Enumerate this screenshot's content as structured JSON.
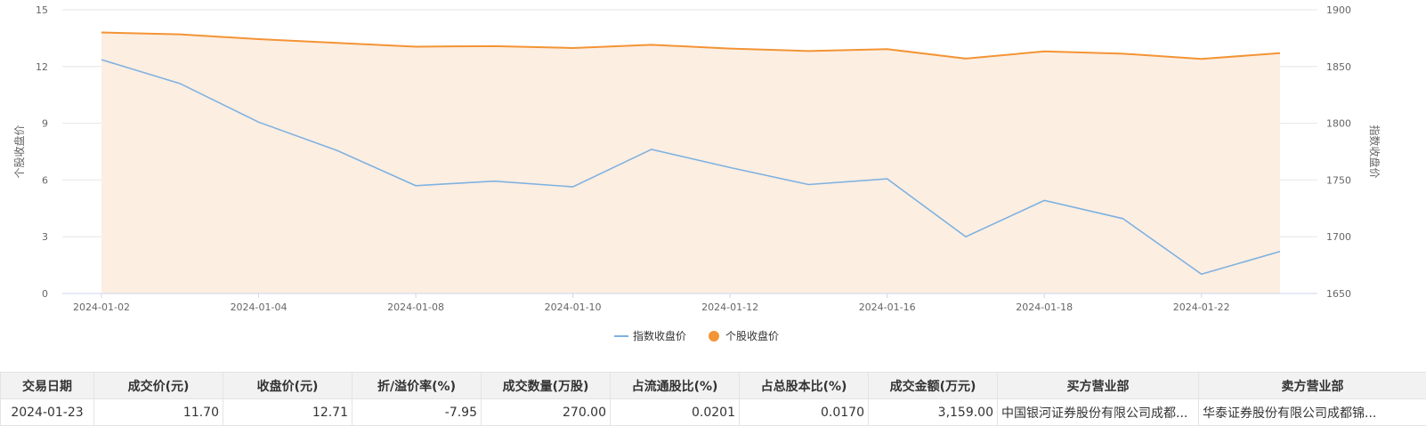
{
  "chart_data": {
    "type": "line",
    "x": [
      "2024-01-02",
      "2024-01-03",
      "2024-01-04",
      "2024-01-05",
      "2024-01-08",
      "2024-01-09",
      "2024-01-10",
      "2024-01-11",
      "2024-01-12",
      "2024-01-15",
      "2024-01-16",
      "2024-01-17",
      "2024-01-18",
      "2024-01-19",
      "2024-01-22",
      "2024-01-23"
    ],
    "x_tick_labels": [
      "2024-01-02",
      "2024-01-04",
      "2024-01-08",
      "2024-01-10",
      "2024-01-12",
      "2024-01-16",
      "2024-01-18",
      "2024-01-22"
    ],
    "series": [
      {
        "name": "指数收盘价",
        "axis": "right",
        "color": "#7eb2e0",
        "values": [
          1856,
          1835,
          1801,
          1776,
          1745,
          1749,
          1744,
          1777,
          1761,
          1746,
          1751,
          1700,
          1732,
          1716,
          1667,
          1687
        ]
      },
      {
        "name": "个股收盘价",
        "axis": "left",
        "color": "#f39435",
        "area_fill": "#fdeee2",
        "values": [
          13.8,
          13.7,
          13.45,
          13.25,
          13.05,
          13.08,
          12.98,
          13.15,
          12.95,
          12.82,
          12.92,
          12.42,
          12.8,
          12.68,
          12.4,
          12.71
        ]
      }
    ],
    "y_left": {
      "label": "个股收盘价",
      "ticks": [
        "0",
        "3",
        "6",
        "9",
        "12",
        "15"
      ],
      "range": [
        0,
        15
      ]
    },
    "y_right": {
      "label": "指数收盘价",
      "ticks": [
        "1650",
        "1700",
        "1750",
        "1800",
        "1850",
        "1900"
      ],
      "range": [
        1650,
        1900
      ]
    },
    "grid": true,
    "legend_position": "bottom-center"
  },
  "table": {
    "headers": [
      "交易日期",
      "成交价(元)",
      "收盘价(元)",
      "折/溢价率(%)",
      "成交数量(万股)",
      "占流通股比(%)",
      "占总股本比(%)",
      "成交金额(万元)",
      "买方营业部",
      "卖方营业部"
    ],
    "rows": [
      [
        "2024-01-23",
        "11.70",
        "12.71",
        "-7.95",
        "270.00",
        "0.0201",
        "0.0170",
        "3,159.00",
        "中国银河证券股份有限公司成都...",
        "华泰证券股份有限公司成都锦..."
      ]
    ]
  }
}
